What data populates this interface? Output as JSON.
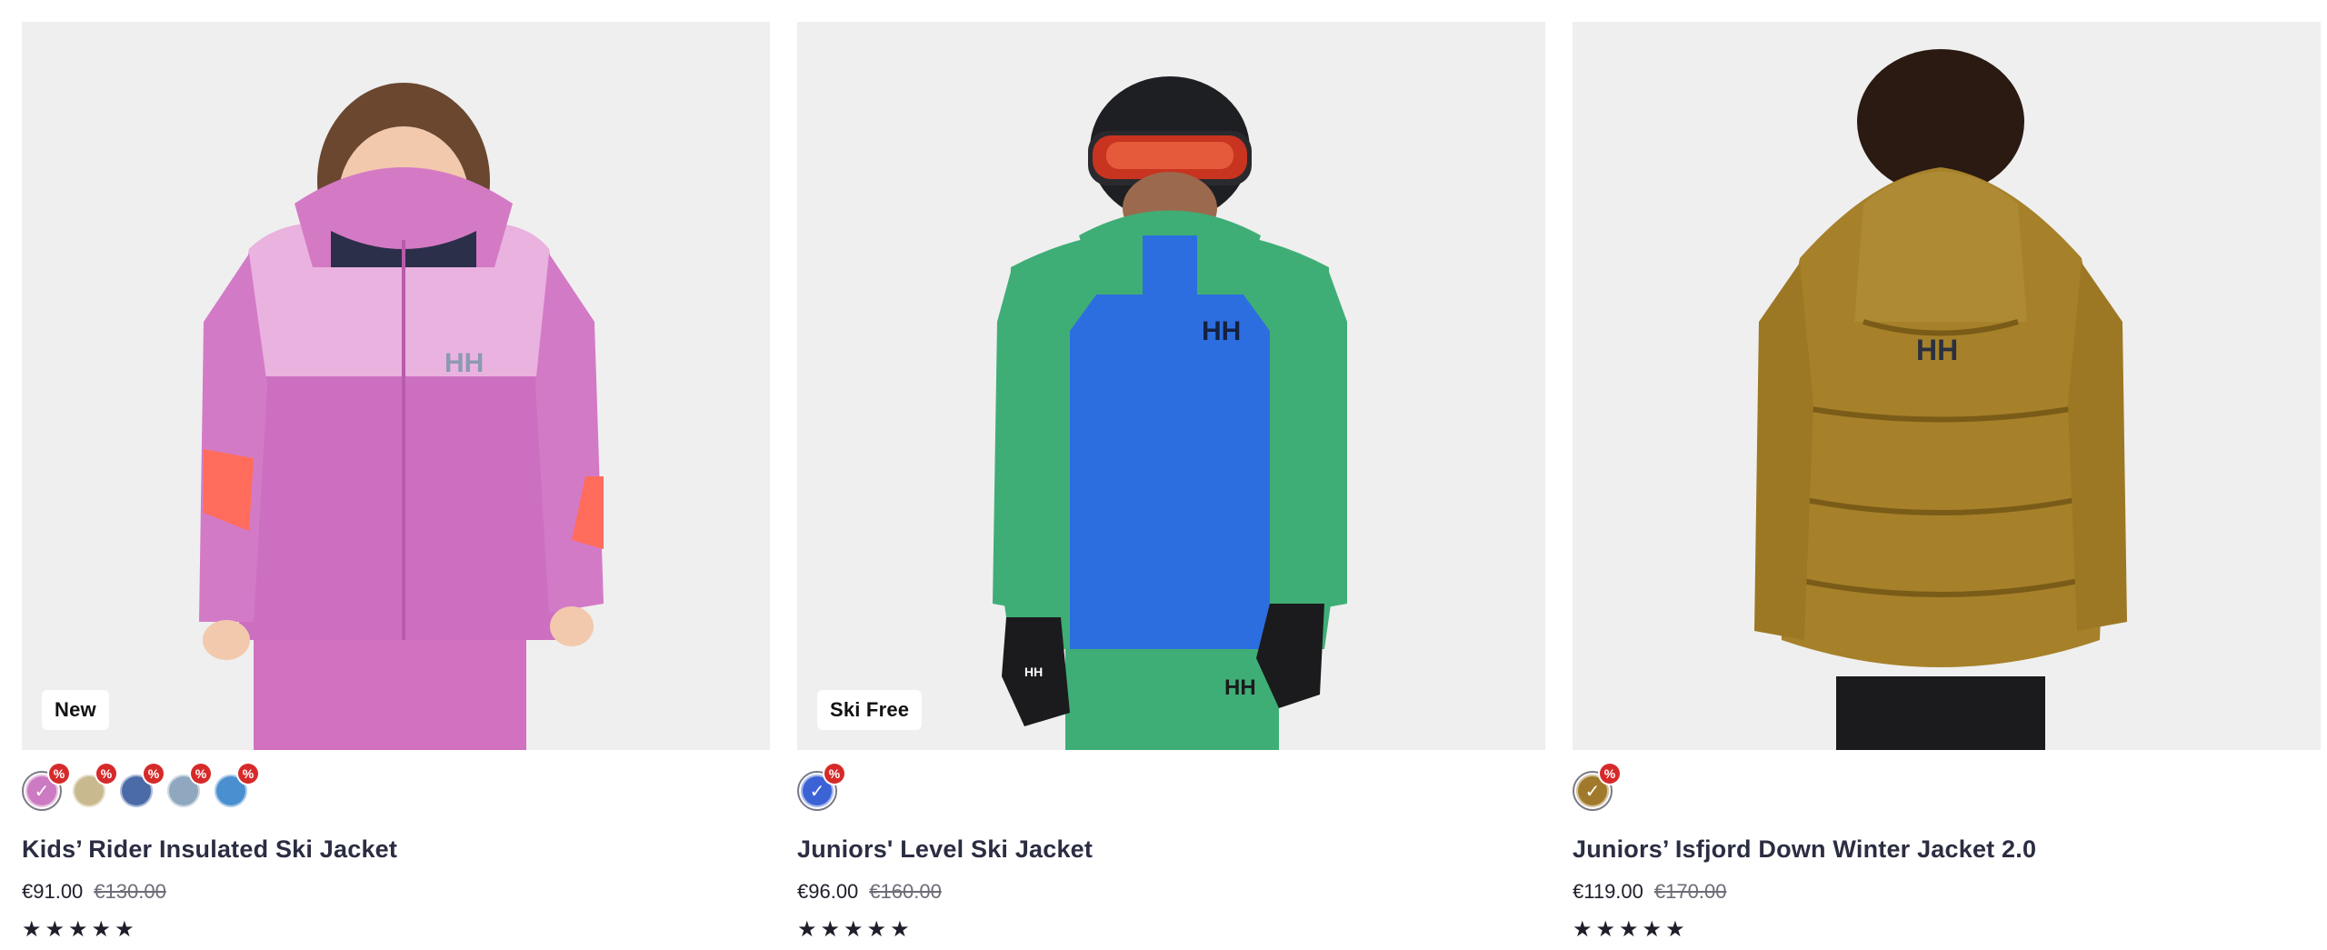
{
  "products": [
    {
      "badge": "New",
      "name": "Kids’ Rider Insulated Ski Jacket",
      "price": "€91.00",
      "old_price": "€130.00",
      "stars": "★★★★★",
      "discount_mark": "%",
      "check": "✓",
      "swatch_colors": [
        "#cc7ac2",
        "#c9b98e",
        "#4a6aa8",
        "#8fa8bf",
        "#4a8fcf"
      ],
      "selected_swatch": 0
    },
    {
      "badge": "Ski Free",
      "name": "Juniors' Level Ski Jacket",
      "price": "€96.00",
      "old_price": "€160.00",
      "stars": "★★★★★",
      "discount_mark": "%",
      "check": "✓",
      "swatch_colors": [
        "#3b63d6"
      ],
      "selected_swatch": 0
    },
    {
      "badge": "",
      "name": "Juniors’ Isfjord Down Winter Jacket 2.0",
      "price": "€119.00",
      "old_price": "€170.00",
      "stars": "★★★★★",
      "discount_mark": "%",
      "check": "✓",
      "swatch_colors": [
        "#a07a2a"
      ],
      "selected_swatch": 0
    }
  ],
  "logo_text": "HH"
}
